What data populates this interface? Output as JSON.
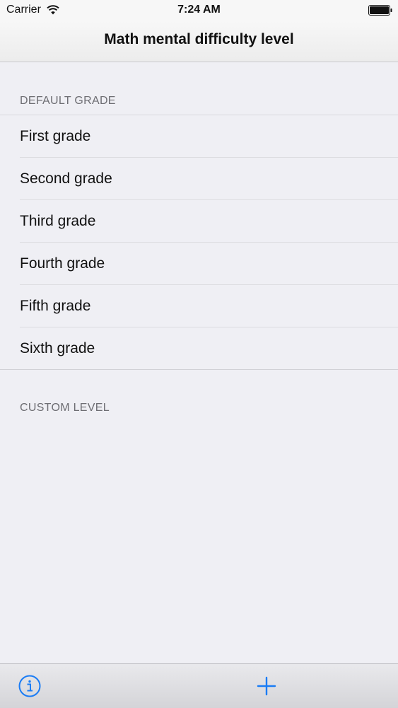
{
  "status_bar": {
    "carrier": "Carrier",
    "time": "7:24 AM"
  },
  "nav": {
    "title": "Math mental difficulty level"
  },
  "sections": {
    "default_header": "DEFAULT GRADE",
    "custom_header": "CUSTOM LEVEL"
  },
  "grades": [
    "First grade",
    "Second grade",
    "Third grade",
    "Fourth grade",
    "Fifth grade",
    "Sixth grade"
  ],
  "toolbar": {
    "info_icon": "info-icon",
    "add_icon": "plus-icon"
  },
  "colors": {
    "accent": "#1a7cf5",
    "background": "#efeff4",
    "section_text": "#6d6d72"
  }
}
